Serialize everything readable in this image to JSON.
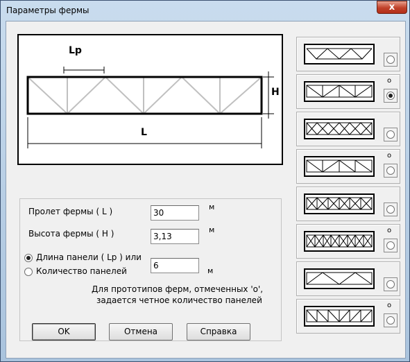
{
  "window": {
    "title": "Параметры фермы",
    "close_label": "x"
  },
  "diagram": {
    "lp_label": "Lp",
    "h_label": "H",
    "l_label": "L"
  },
  "params": {
    "span_label": "Пролет фермы ( L )",
    "span_value": "30",
    "span_unit": "м",
    "height_label": "Высота фермы ( H )",
    "height_value": "3,13",
    "height_unit": "м",
    "panel_length_label": "Длина панели ( Lp ) или",
    "panel_count_label": "Количество панелей",
    "panel_value": "6",
    "panel_unit": "м",
    "selected_mode": "panel_length",
    "note_line1": "Для прототипов ферм, отмеченных 'о',",
    "note_line2": "задается четное количество панелей"
  },
  "buttons": {
    "ok": "OK",
    "cancel": "Отмена",
    "help": "Справка"
  },
  "prototypes": [
    {
      "id": 1,
      "even_mark": "",
      "selected": false
    },
    {
      "id": 2,
      "even_mark": "o",
      "selected": true
    },
    {
      "id": 3,
      "even_mark": "",
      "selected": false
    },
    {
      "id": 4,
      "even_mark": "o",
      "selected": false
    },
    {
      "id": 5,
      "even_mark": "",
      "selected": false
    },
    {
      "id": 6,
      "even_mark": "o",
      "selected": false
    },
    {
      "id": 7,
      "even_mark": "",
      "selected": false
    },
    {
      "id": 8,
      "even_mark": "o",
      "selected": false
    }
  ]
}
